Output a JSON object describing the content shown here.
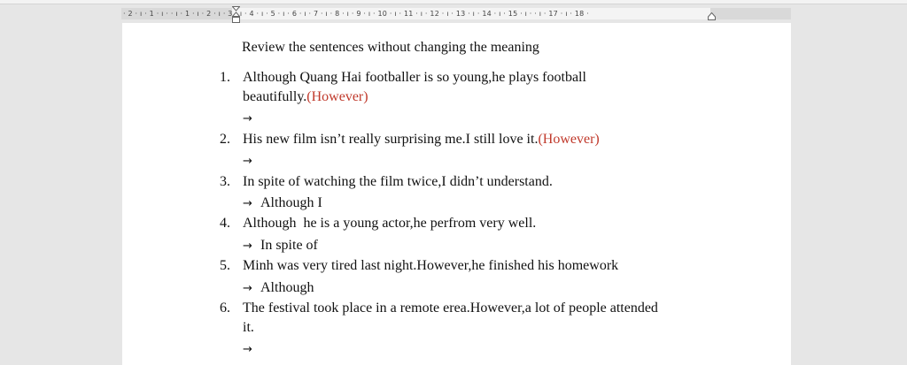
{
  "ruler": {
    "ticks": "· 2 · ı · 1 · ı ·       · ı · 1 · ı · 2 · ı · 3 · ı · 4 · ı · 5 · ı · 6 · ı · 7 · ı · 8 · ı · 9 · ı · 10 · ı · 11 · ı · 12 · ı · 13 · ı · 14 · ı · 15 · ı ·   · ı · 17 · ı · 18 ·"
  },
  "document": {
    "title": "Review the sentences without changing the meaning",
    "items": [
      {
        "number": "1.",
        "line1": "Although Quang Hai footballer is so young,he plays football",
        "line2": "beautifully.",
        "hint": "(However)",
        "arrow": "→",
        "answer": ""
      },
      {
        "number": "2.",
        "line1": "His new film isn’t really surprising me.I still love it.",
        "hint": "(However)",
        "arrow": "→",
        "answer": ""
      },
      {
        "number": "3.",
        "line1": "In spite of watching the film twice,I didn’t understand.",
        "arrow": "→",
        "answer": "Although I"
      },
      {
        "number": "4.",
        "line1": "Although  he is a young actor,he perfrom very well.",
        "arrow": "→",
        "answer": "In spite of"
      },
      {
        "number": "5.",
        "line1": "Minh was very tired last night.However,he finished his homework",
        "arrow": "→",
        "answer": "Although"
      },
      {
        "number": "6.",
        "line1": "The festival took place in a remote erea.However,a lot of people attended",
        "line2": "it.",
        "arrow": "→",
        "answer": ""
      }
    ]
  }
}
